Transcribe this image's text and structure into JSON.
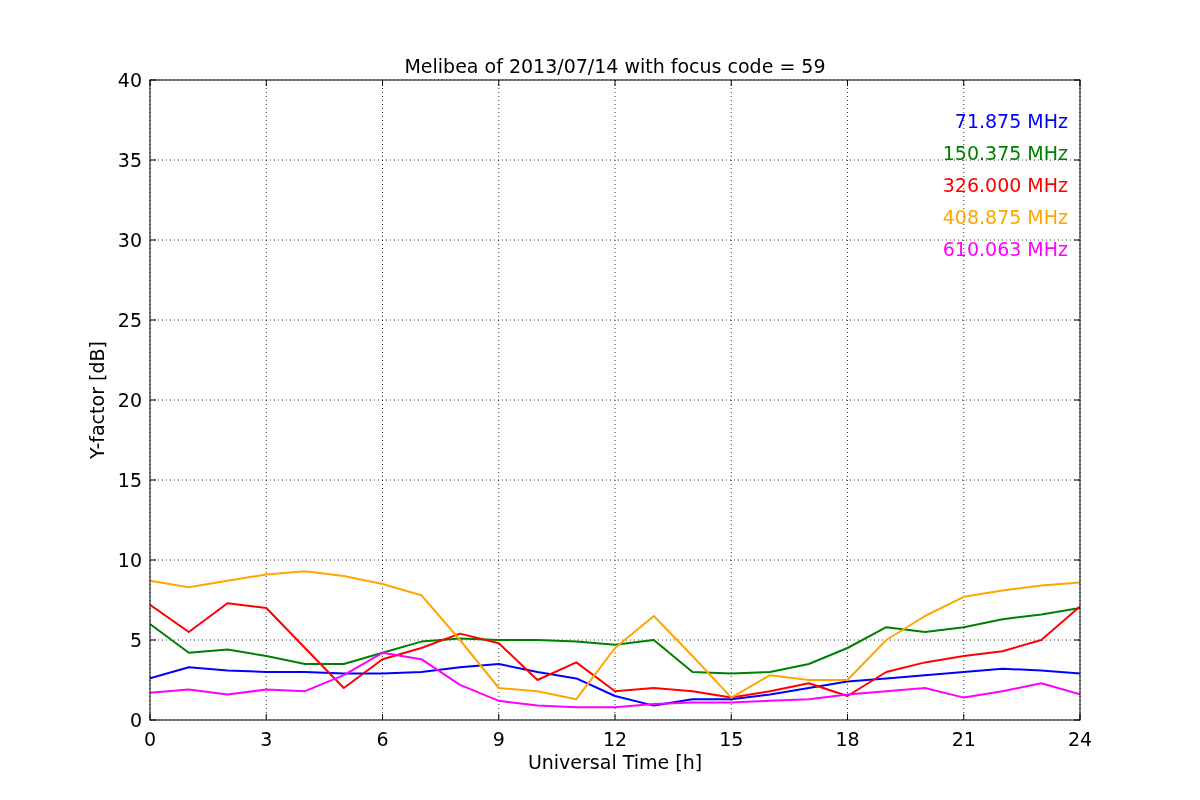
{
  "figure": {
    "chart_data": {
      "type": "line",
      "title": "Melibea of 2013/07/14 with focus code = 59",
      "xlabel": "Universal Time [h]",
      "ylabel": "Y-factor [dB]",
      "x": [
        0,
        1,
        2,
        3,
        4,
        5,
        6,
        7,
        8,
        9,
        10,
        11,
        12,
        13,
        14,
        15,
        16,
        17,
        18,
        19,
        20,
        21,
        22,
        23,
        24
      ],
      "series": [
        {
          "name": "71.875 MHz",
          "color": "#0000ff",
          "values": [
            2.6,
            3.3,
            3.1,
            3.0,
            3.0,
            2.9,
            2.9,
            3.0,
            3.3,
            3.5,
            3.0,
            2.6,
            1.5,
            0.9,
            1.3,
            1.3,
            1.6,
            2.0,
            2.4,
            2.6,
            2.8,
            3.0,
            3.2,
            3.1,
            2.9
          ]
        },
        {
          "name": "150.375 MHz",
          "color": "#008000",
          "values": [
            6.0,
            4.2,
            4.4,
            4.0,
            3.5,
            3.5,
            4.2,
            4.9,
            5.1,
            5.0,
            5.0,
            4.9,
            4.7,
            5.0,
            3.0,
            2.9,
            3.0,
            3.5,
            4.5,
            5.8,
            5.5,
            5.8,
            6.3,
            6.6,
            7.0
          ]
        },
        {
          "name": "326.000 MHz",
          "color": "#ff0000",
          "values": [
            7.2,
            5.5,
            7.3,
            7.0,
            4.5,
            2.0,
            3.8,
            4.5,
            5.4,
            4.8,
            2.5,
            3.6,
            1.8,
            2.0,
            1.8,
            1.4,
            1.8,
            2.3,
            1.5,
            3.0,
            3.6,
            4.0,
            4.3,
            5.0,
            7.1
          ]
        },
        {
          "name": "408.875 MHz",
          "color": "#ffa500",
          "values": [
            8.7,
            8.3,
            8.7,
            9.1,
            9.3,
            9.0,
            8.5,
            7.8,
            5.0,
            2.0,
            1.8,
            1.3,
            4.5,
            6.5,
            4.0,
            1.4,
            2.8,
            2.5,
            2.5,
            5.0,
            6.5,
            7.7,
            8.1,
            8.4,
            8.6
          ]
        },
        {
          "name": "610.063 MHz",
          "color": "#ff00ff",
          "values": [
            1.7,
            1.9,
            1.6,
            1.9,
            1.8,
            2.8,
            4.2,
            3.8,
            2.2,
            1.2,
            0.9,
            0.8,
            0.8,
            1.0,
            1.1,
            1.1,
            1.2,
            1.3,
            1.6,
            1.8,
            2.0,
            1.4,
            1.8,
            2.3,
            1.6
          ]
        }
      ],
      "xlim": [
        0,
        24
      ],
      "ylim": [
        0,
        40
      ],
      "xticks": [
        0,
        3,
        6,
        9,
        12,
        15,
        18,
        21,
        24
      ],
      "yticks": [
        0,
        5,
        10,
        15,
        20,
        25,
        30,
        35,
        40
      ],
      "grid": true
    }
  }
}
